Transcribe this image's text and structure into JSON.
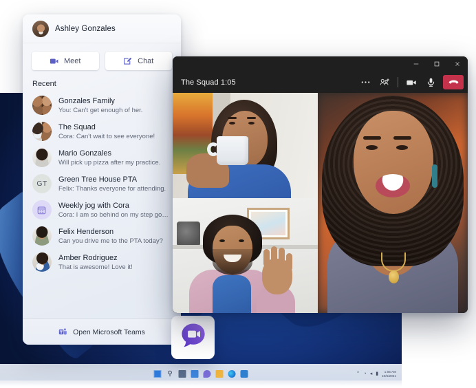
{
  "flyout": {
    "user": {
      "name": "Ashley Gonzales",
      "avatar_icon": "user-avatar-photo"
    },
    "quick_actions": [
      {
        "label": "Meet",
        "icon": "video-camera-icon"
      },
      {
        "label": "Chat",
        "icon": "compose-pencil-icon"
      }
    ],
    "recent_label": "Recent",
    "recent": [
      {
        "title": "Gonzales Family",
        "preview": "You: Can't get enough of her.",
        "avatar": "group-photo-avatar"
      },
      {
        "title": "The Squad",
        "preview": "Cora: Can't wait to see everyone!",
        "avatar": "group-photo-avatar"
      },
      {
        "title": "Mario Gonzales",
        "preview": "Will pick up pizza after my practice.",
        "avatar": "person-photo-avatar"
      },
      {
        "title": "Green Tree House PTA",
        "preview": "Felix: Thanks everyone for attending.",
        "avatar": "initials-avatar",
        "initials": "GT"
      },
      {
        "title": "Weekly jog with Cora",
        "preview": "Cora: I am so behind on my step goals.",
        "avatar": "calendar-icon"
      },
      {
        "title": "Felix Henderson",
        "preview": "Can you drive me to the PTA today?",
        "avatar": "person-photo-avatar"
      },
      {
        "title": "Amber Rodriguez",
        "preview": "That is awesome! Love it!",
        "avatar": "person-photo-avatar"
      }
    ],
    "footer": {
      "label": "Open Microsoft Teams",
      "icon": "microsoft-teams-logo-icon"
    }
  },
  "chat_tile": {
    "icon": "teams-chat-bubble-video-icon"
  },
  "call_window": {
    "title": "The Squad 1:05",
    "window_controls": [
      {
        "name": "minimize",
        "glyph": "─"
      },
      {
        "name": "maximize",
        "glyph": "☐"
      },
      {
        "name": "close",
        "glyph": "✕"
      }
    ],
    "controls": [
      {
        "name": "more-options",
        "icon": "ellipsis-icon",
        "glyph": "…"
      },
      {
        "name": "add-people",
        "icon": "add-person-icon",
        "glyph": ""
      },
      {
        "name": "toggle-camera",
        "icon": "video-camera-icon",
        "glyph": ""
      },
      {
        "name": "toggle-microphone",
        "icon": "microphone-icon",
        "glyph": ""
      },
      {
        "name": "hang-up",
        "icon": "hang-up-phone-icon",
        "glyph": ""
      }
    ],
    "participants": [
      {
        "position": "top-left",
        "description": "Woman drinking from a mug"
      },
      {
        "position": "bottom-left",
        "description": "Man waving hello"
      },
      {
        "position": "right-large",
        "description": "Woman laughing"
      }
    ]
  },
  "desktop": {
    "wallpaper": "windows-11-bloom",
    "taskbar": {
      "icons": [
        {
          "name": "start-icon"
        },
        {
          "name": "search-icon",
          "glyph": "⚲"
        },
        {
          "name": "task-view-icon"
        },
        {
          "name": "widgets-icon"
        },
        {
          "name": "teams-chat-icon"
        },
        {
          "name": "file-explorer-icon"
        },
        {
          "name": "edge-browser-icon"
        },
        {
          "name": "microsoft-store-icon"
        }
      ],
      "tray": {
        "chevron": "⌃",
        "network": "◔",
        "volume": "◂",
        "battery": "▮",
        "clock_time": "1:05 AM",
        "clock_date": "10/5/2021"
      }
    }
  },
  "colors": {
    "teams_purple": "#5b5fc7",
    "hangup_red": "#c4314b",
    "titlebar_dark": "#201f1f",
    "panel_bg": "#eef1f7"
  }
}
